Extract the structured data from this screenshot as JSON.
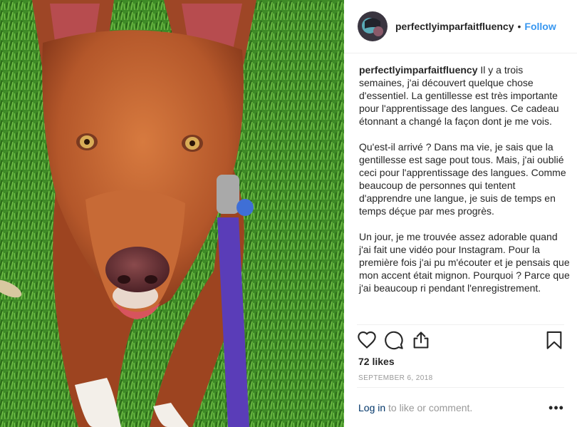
{
  "post": {
    "username": "perfectlyimparfaitfluency",
    "separator": "•",
    "follow_label": "Follow",
    "caption_paragraphs": [
      "Il y a trois semaines, j'ai découvert quelque chose d'essentiel. La gentillesse est très importante pour l'apprentissage des langues. Ce cadeau étonnant a changé la façon dont je me vois.",
      "Qu'est-il arrivé ? Dans ma vie, je sais que la gentillesse est sage pout tous. Mais, j'ai oublié ceci pour l'apprentissage des langues. Comme beaucoup de personnes qui tentent d'apprendre une langue, je suis de temps en temps déçue par mes progrès.",
      "Un jour, je me trouvée assez adorable quand j'ai fait une vidéo pour Instagram. Pour la première fois j'ai pu m'écouter et je pensais que mon accent était mignon. Pourquoi ? Parce que j'ai beaucoup ri pendant l'enregistrement."
    ],
    "likes": "72 likes",
    "date": "SEPTEMBER 6, 2018",
    "login_link": "Log in",
    "login_rest": " to like or comment.",
    "more_label": "•••"
  },
  "icons": {
    "like": "heart-icon",
    "comment": "comment-bubble-icon",
    "share": "share-icon",
    "save": "bookmark-icon",
    "more": "more-options-icon"
  },
  "colors": {
    "link_blue": "#3897f0",
    "login_link": "#003569",
    "muted": "#999999",
    "text": "#262626"
  }
}
